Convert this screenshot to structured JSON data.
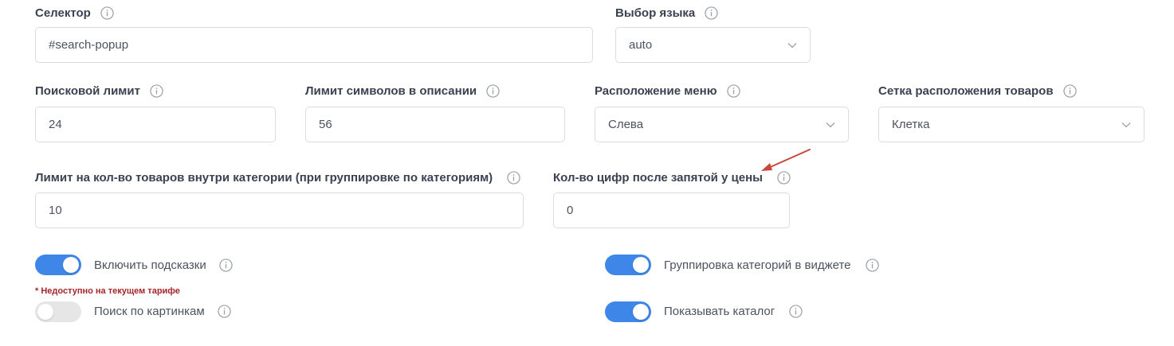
{
  "selector": {
    "label": "Селектор",
    "value": "#search-popup"
  },
  "language": {
    "label": "Выбор языка",
    "value": "auto"
  },
  "search_limit": {
    "label": "Поисковой лимит",
    "value": "24"
  },
  "desc_limit": {
    "label": "Лимит символов в описании",
    "value": "56"
  },
  "menu_position": {
    "label": "Расположение меню",
    "value": "Слева"
  },
  "grid": {
    "label": "Сетка расположения товаров",
    "value": "Клетка"
  },
  "category_limit": {
    "label": "Лимит на кол-во товаров внутри категории (при группировке по категориям)",
    "value": "10"
  },
  "price_decimals": {
    "label": "Кол-во цифр после запятой у цены",
    "value": "0"
  },
  "toggles": {
    "hints": {
      "label": "Включить подсказки",
      "on": true
    },
    "image_search": {
      "label": "Поиск по картинкам",
      "on": false,
      "note": "* Недоступно на текущем тарифе"
    },
    "group_categories": {
      "label": "Группировка категорий в виджете",
      "on": true
    },
    "show_catalog": {
      "label": "Показывать каталог",
      "on": true
    }
  },
  "colors": {
    "accent": "#3e87e8",
    "warning": "#a2262a",
    "arrow": "#c8463a"
  }
}
